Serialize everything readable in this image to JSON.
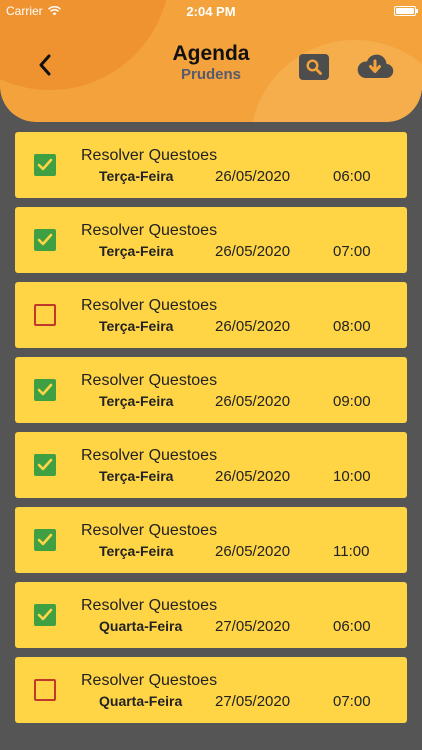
{
  "status_bar": {
    "carrier": "Carrier",
    "time": "2:04 PM"
  },
  "header": {
    "title": "Agenda",
    "subtitle": "Prudens",
    "back_icon": "chevron-left-icon",
    "search_icon": "search-icon",
    "download_icon": "cloud-download-icon"
  },
  "colors": {
    "header_bg": "#F3A23C",
    "card_bg": "#FFD546",
    "page_bg": "#555555",
    "check_on": "#3EA042",
    "check_off": "#C0392B"
  },
  "items": [
    {
      "task": "Resolver Questoes",
      "day": "Terça-Feira",
      "date": "26/05/2020",
      "time": "06:00",
      "checked": true
    },
    {
      "task": "Resolver Questoes",
      "day": "Terça-Feira",
      "date": "26/05/2020",
      "time": "07:00",
      "checked": true
    },
    {
      "task": "Resolver Questoes",
      "day": "Terça-Feira",
      "date": "26/05/2020",
      "time": "08:00",
      "checked": false
    },
    {
      "task": "Resolver Questoes",
      "day": "Terça-Feira",
      "date": "26/05/2020",
      "time": "09:00",
      "checked": true
    },
    {
      "task": "Resolver Questoes",
      "day": "Terça-Feira",
      "date": "26/05/2020",
      "time": "10:00",
      "checked": true
    },
    {
      "task": "Resolver Questoes",
      "day": "Terça-Feira",
      "date": "26/05/2020",
      "time": "11:00",
      "checked": true
    },
    {
      "task": "Resolver Questoes",
      "day": "Quarta-Feira",
      "date": "27/05/2020",
      "time": "06:00",
      "checked": true
    },
    {
      "task": "Resolver Questoes",
      "day": "Quarta-Feira",
      "date": "27/05/2020",
      "time": "07:00",
      "checked": false
    }
  ]
}
